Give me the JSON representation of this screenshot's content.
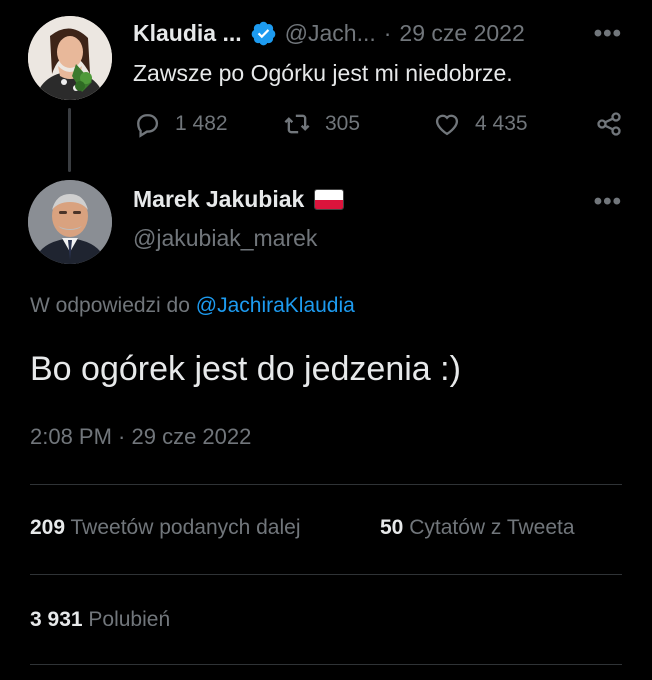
{
  "parent_tweet": {
    "display_name": "Klaudia ...",
    "handle": "@Jach...",
    "separator": "·",
    "date": "29 cze 2022",
    "text": "Zawsze po Ogórku jest mi niedobrze.",
    "replies": "1 482",
    "retweets": "305",
    "likes": "4 435",
    "more_label": "•••"
  },
  "main_tweet": {
    "display_name": "Marek Jakubiak",
    "handle": "@jakubiak_marek",
    "reply_prefix": "W odpowiedzi do",
    "reply_to": "@JachiraKlaudia",
    "text": "Bo ogórek jest do jedzenia :)",
    "timestamp": "2:08 PM · 29 cze 2022",
    "more_label": "•••",
    "stats": {
      "retweets_count": "209",
      "retweets_label": "Tweetów podanych dalej",
      "quotes_count": "50",
      "quotes_label": "Cytatów z Tweeta",
      "likes_count": "3 931",
      "likes_label": "Polubień"
    }
  },
  "colors": {
    "background": "#000000",
    "text": "#e7e9ea",
    "muted": "#71767b",
    "link": "#1d9bf0",
    "verified": "#1d9bf0",
    "divider": "#2f3336"
  },
  "icons": [
    "verified-badge-icon",
    "reply-icon",
    "retweet-icon",
    "like-icon",
    "share-icon",
    "more-icon",
    "poland-flag-icon"
  ]
}
